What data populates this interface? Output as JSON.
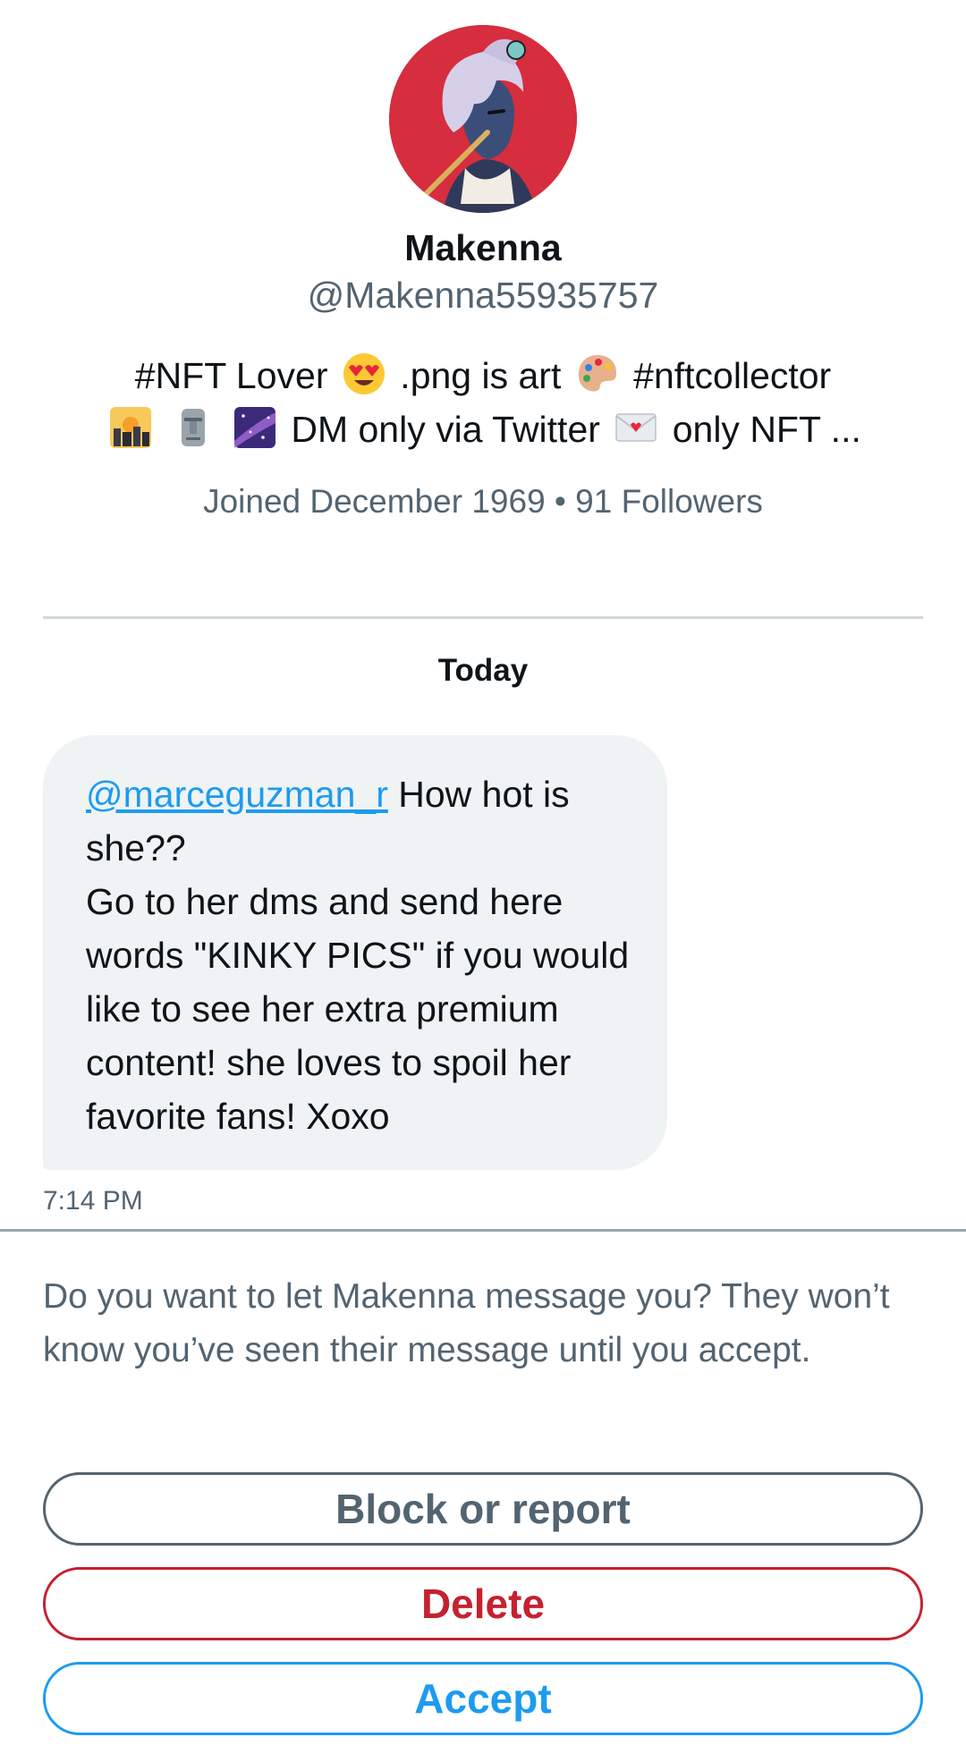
{
  "profile": {
    "display_name": "Makenna",
    "handle": "@Makenna55935757",
    "bio": {
      "line1_a": "#NFT Lover",
      "line1_emoji1": "smiling-face-heart-eyes",
      "line1_b": ".png is art",
      "line1_emoji2": "artist-palette",
      "line1_c": "#nftcollector",
      "line2_emojis": [
        "sunset-over-city",
        "moai",
        "milky-way"
      ],
      "line2_a": "DM only via Twitter",
      "line2_emoji": "love-letter",
      "line2_b": "only NFT ..."
    },
    "meta": "Joined December 1969 • 91 Followers"
  },
  "conversation": {
    "date_label": "Today",
    "message": {
      "mention": "@marceguzman_r",
      "text": " How hot is she??\nGo to her dms and send here words \"KINKY PICS\" if you would like to see her extra premium content! she loves to spoil her favorite fans! Xoxo",
      "time": "7:14 PM"
    }
  },
  "request": {
    "prompt": "Do you want to let Makenna message you? They won’t know you’ve seen their message until you accept.",
    "block_label": "Block or report",
    "delete_label": "Delete",
    "accept_label": "Accept"
  },
  "colors": {
    "link": "#1d9bf0",
    "danger": "#c5212f",
    "secondary_text": "#536471",
    "bubble_bg": "#eff3f4",
    "avatar_bg": "#d62d3f"
  }
}
